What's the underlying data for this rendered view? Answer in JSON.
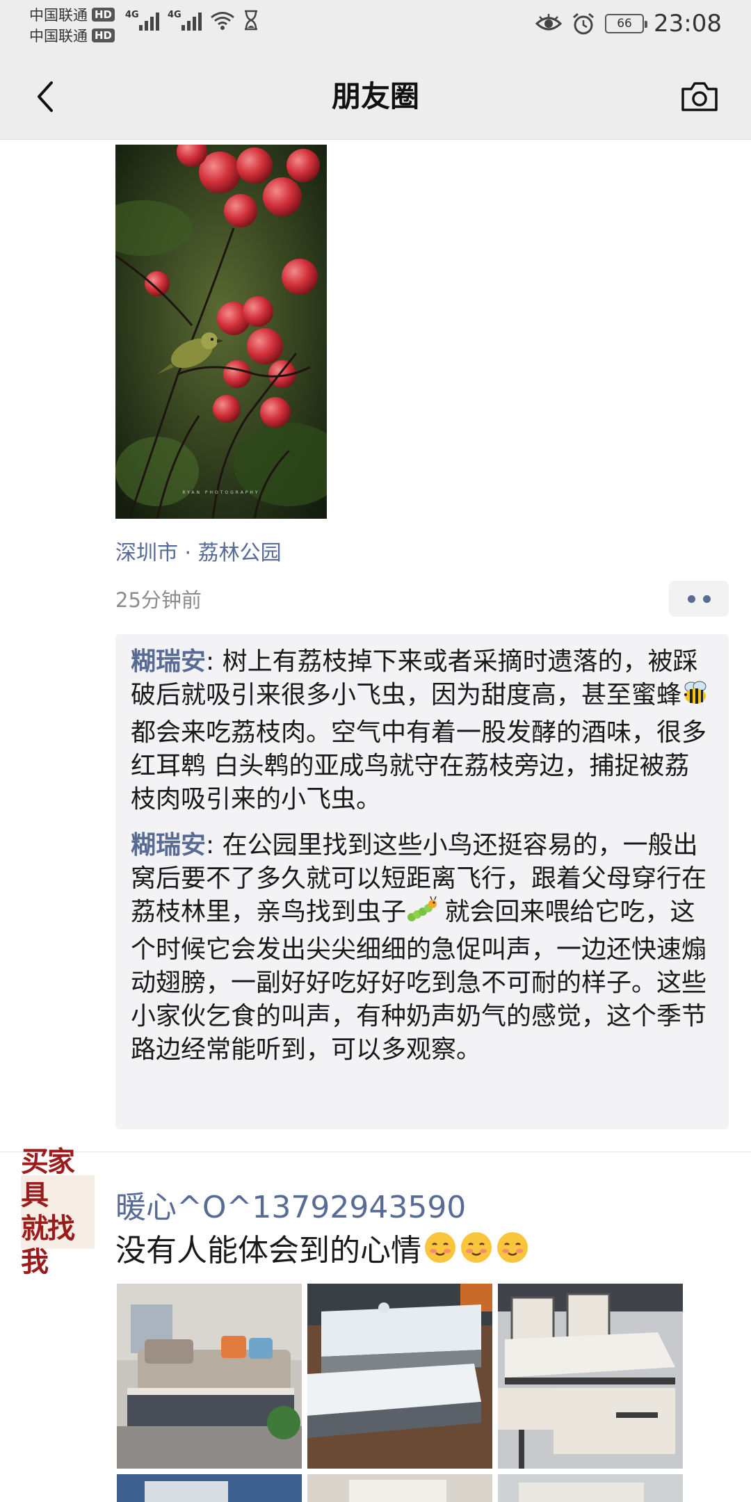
{
  "status_bar": {
    "carrier1": "中国联通",
    "carrier2": "中国联通",
    "hd_label": "HD",
    "network1": "4G",
    "network2": "4G",
    "battery": "66",
    "time": "23:08"
  },
  "header": {
    "title": "朋友圈",
    "back_icon": "back-chevron-icon",
    "camera_icon": "camera-icon"
  },
  "post1": {
    "photo_watermark": "RYAN PHOTOGRAPHY",
    "location": "深圳市 · 荔林公园",
    "time_ago": "25分钟前",
    "comments": [
      {
        "author": "糊瑞安",
        "text_before_emoji": ": 树上有荔枝掉下来或者采摘时遗落的，被踩破后就吸引来很多小飞虫，因为甜度高，甚至蜜蜂",
        "emoji": "bee-emoji",
        "text_after_emoji": " 都会来吃荔枝肉。空气中有着一股发酵的酒味，很多红耳鹎 白头鹎的亚成鸟就守在荔枝旁边，捕捉被荔枝肉吸引来的小飞虫。"
      },
      {
        "author": "糊瑞安",
        "text_before_emoji": ": 在公园里找到这些小鸟还挺容易的，一般出窝后要不了多久就可以短距离飞行，跟着父母穿行在荔枝林里，亲鸟找到虫子",
        "emoji": "caterpillar-emoji",
        "text_after_emoji": " 就会回来喂给它吃，这个时候它会发出尖尖细细的急促叫声，一边还快速煽动翅膀，一副好好吃好好吃到急不可耐的样子。这些小家伙乞食的叫声，有种奶声奶气的感觉，这个季节路边经常能听到，可以多观察。"
      }
    ]
  },
  "post2": {
    "avatar_line1": "买家具",
    "avatar_line2": "就找我",
    "name": "暖心^O^13792943590",
    "text": "没有人能体会到的心情",
    "emoji": "smiling-face-emoji"
  },
  "colors": {
    "link_blue": "#576b95",
    "header_bg": "#ededed",
    "comment_bg": "#f3f3f5"
  }
}
